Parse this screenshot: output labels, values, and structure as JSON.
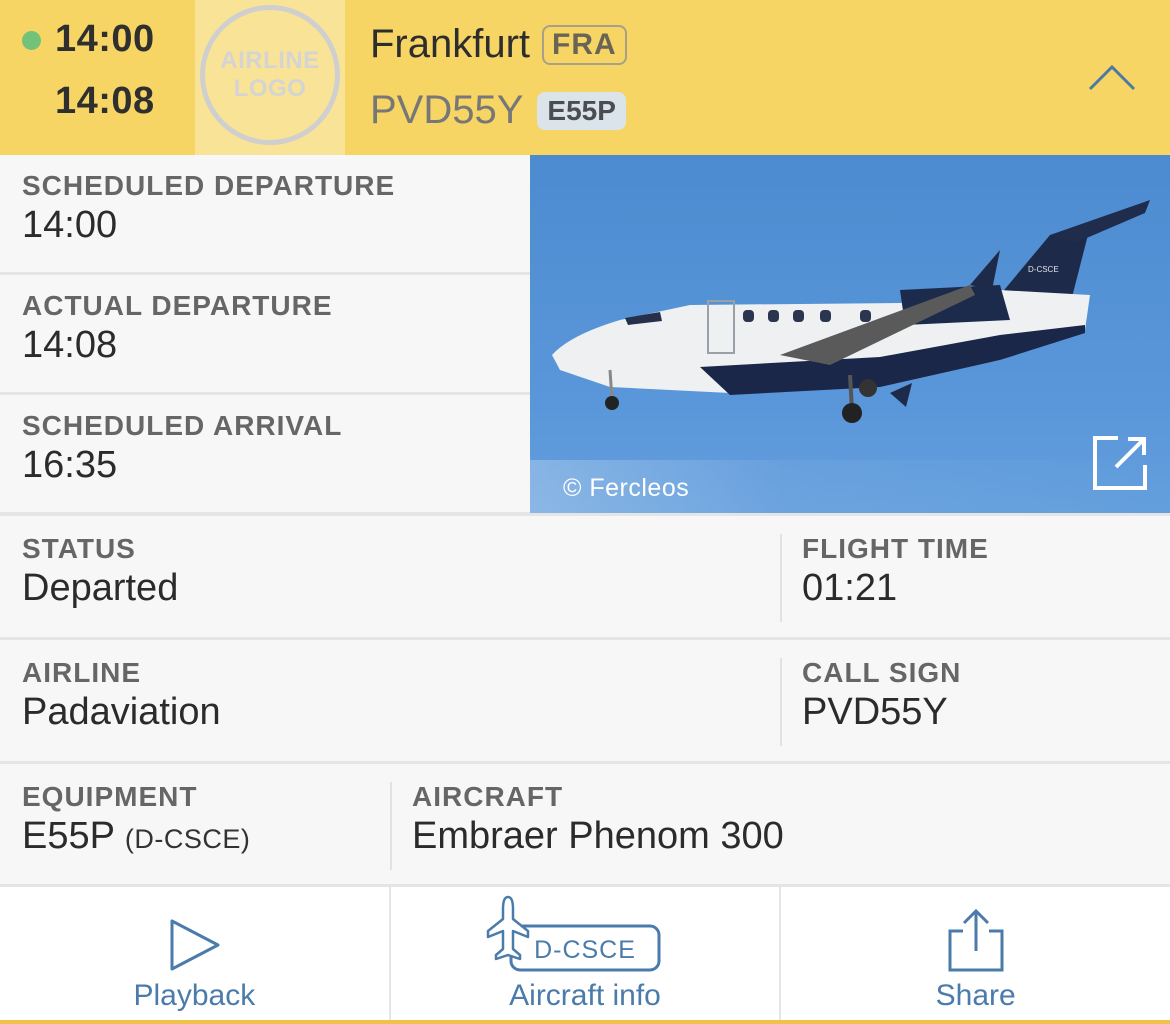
{
  "header": {
    "status_dot_color": "#72c27a",
    "scheduled_time": "14:00",
    "actual_time": "14:08",
    "airline_logo_line1": "AIRLINE",
    "airline_logo_line2": "LOGO",
    "destination_name": "Frankfurt",
    "destination_code": "FRA",
    "flight_number": "PVD55Y",
    "aircraft_type": "E55P",
    "collapse_icon": "chevron-up-icon"
  },
  "times": [
    {
      "label": "SCHEDULED DEPARTURE",
      "value": "14:00"
    },
    {
      "label": "ACTUAL DEPARTURE",
      "value": "14:08"
    },
    {
      "label": "SCHEDULED ARRIVAL",
      "value": "16:35"
    }
  ],
  "photo": {
    "credit": "© Fercleos",
    "registration_on_tail": "D-CSCE",
    "expand_icon": "external-link-icon"
  },
  "details": {
    "status": {
      "label": "STATUS",
      "value": "Departed"
    },
    "flight_time": {
      "label": "FLIGHT TIME",
      "value": "01:21"
    },
    "airline": {
      "label": "AIRLINE",
      "value": "Padaviation"
    },
    "call_sign": {
      "label": "CALL SIGN",
      "value": "PVD55Y"
    },
    "equipment": {
      "label": "EQUIPMENT",
      "value": "E55P",
      "registration": "(D-CSCE)"
    },
    "aircraft": {
      "label": "AIRCRAFT",
      "value": "Embraer Phenom 300"
    }
  },
  "actions": [
    {
      "label": "Playback",
      "icon": "play-icon"
    },
    {
      "label": "Aircraft info",
      "icon": "aircraft-registration-icon",
      "badge": "D-CSCE"
    },
    {
      "label": "Share",
      "icon": "share-icon"
    }
  ],
  "colors": {
    "header_bg": "#f7d565",
    "accent_blue": "#4a7bab",
    "bottom_bar": "#f0c24a"
  }
}
